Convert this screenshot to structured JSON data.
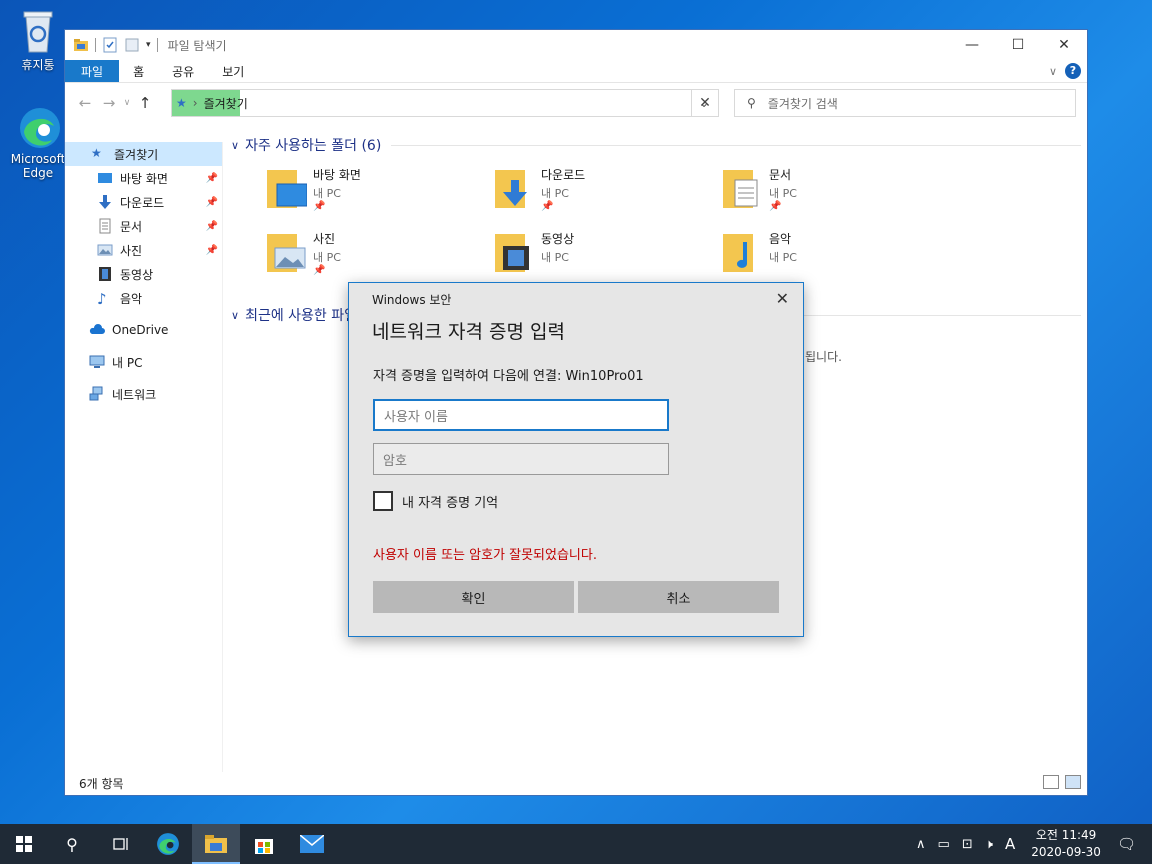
{
  "desktop": {
    "recycle_bin": "휴지통",
    "edge_line1": "Microsoft",
    "edge_line2": "Edge"
  },
  "explorer": {
    "title": "파일 탐색기",
    "ribbon_tabs": [
      "파일",
      "홈",
      "공유",
      "보기"
    ],
    "help": "?",
    "address": "즐겨찾기",
    "search_placeholder": "즐겨찾기 검색",
    "sidebar": [
      {
        "label": "즐겨찾기",
        "pinned": false
      },
      {
        "label": "바탕 화면",
        "pinned": true
      },
      {
        "label": "다운로드",
        "pinned": true
      },
      {
        "label": "문서",
        "pinned": true
      },
      {
        "label": "사진",
        "pinned": true
      },
      {
        "label": "동영상",
        "pinned": false
      },
      {
        "label": "음악",
        "pinned": false
      },
      {
        "label": "OneDrive",
        "pinned": false
      },
      {
        "label": "내 PC",
        "pinned": false
      },
      {
        "label": "네트워크",
        "pinned": false
      }
    ],
    "group_frequent": "자주 사용하는 폴더 (6)",
    "group_recent": "최근에 사용한 파일",
    "recent_tail": "됩니다.",
    "folders": [
      {
        "name": "바탕 화면",
        "loc": "내 PC"
      },
      {
        "name": "다운로드",
        "loc": "내 PC"
      },
      {
        "name": "문서",
        "loc": "내 PC"
      },
      {
        "name": "사진",
        "loc": "내 PC"
      },
      {
        "name": "동영상",
        "loc": "내 PC"
      },
      {
        "name": "음악",
        "loc": "내 PC"
      }
    ],
    "status": "6개 항목"
  },
  "dialog": {
    "app": "Windows 보안",
    "title": "네트워크 자격 증명 입력",
    "message": "자격 증명을 입력하여 다음에 연결: Win10Pro01",
    "username_placeholder": "사용자 이름",
    "password_placeholder": "암호",
    "remember": "내 자격 증명 기억",
    "error": "사용자 이름 또는 암호가 잘못되었습니다.",
    "ok": "확인",
    "cancel": "취소",
    "error_color": "#c00000"
  },
  "taskbar": {
    "ime": "A",
    "time": "오전 11:49",
    "date": "2020-09-30"
  }
}
